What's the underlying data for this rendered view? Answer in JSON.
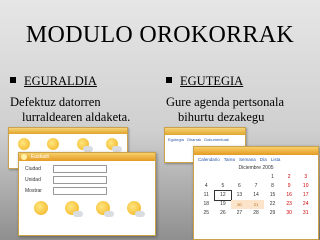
{
  "slide": {
    "title": "MODULO OROKORRAK",
    "left": {
      "heading": "EGURALDIA",
      "desc_line1": "Defektuz datorren",
      "desc_line2": "lurraldearen aldaketa."
    },
    "right": {
      "heading": "EGUTEGIA",
      "desc_line1": "Gure agenda pertsonala",
      "desc_line2": "bihurtu dezakegu"
    }
  },
  "weather_widget": {
    "title": "Euskadi",
    "fields": [
      {
        "label": "Ciudad"
      },
      {
        "label": "Unidad"
      },
      {
        "label": "Mostrar"
      }
    ]
  },
  "notes_widget": {
    "tabs": [
      "Egutegia",
      "Oharrak",
      "Dokumentuak"
    ]
  },
  "calendar_widget": {
    "month": "Diciembre 2005",
    "tabs": [
      "Calendario",
      "Tarea",
      "Semana",
      "Día",
      "Lista"
    ],
    "weeks": [
      [
        "",
        "",
        "",
        "",
        "1",
        "2",
        "3"
      ],
      [
        "4",
        "5",
        "6",
        "7",
        "8",
        "9",
        "10"
      ],
      [
        "11",
        "12",
        "13",
        "14",
        "15",
        "16",
        "17"
      ],
      [
        "18",
        "19",
        "20",
        "21",
        "22",
        "23",
        "24"
      ],
      [
        "25",
        "26",
        "27",
        "28",
        "29",
        "30",
        "31"
      ]
    ]
  }
}
